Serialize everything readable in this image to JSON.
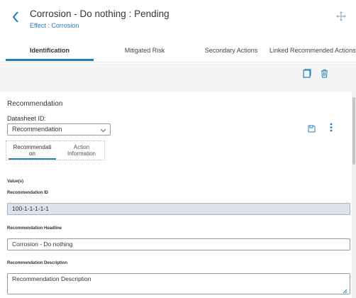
{
  "header": {
    "title": "Corrosion - Do nothing : Pending",
    "subtitle": "Effect : Corrosion"
  },
  "tabs": [
    {
      "label": "Identification",
      "active": true
    },
    {
      "label": "Mitigated Risk",
      "active": false
    },
    {
      "label": "Secondary Actions",
      "active": false
    },
    {
      "label": "Linked Recommended Actions",
      "active": false
    }
  ],
  "section": {
    "title": "Recommendation",
    "datasheet_label": "Datasheet ID:",
    "datasheet_value": "Recommendation"
  },
  "subtabs": [
    {
      "label": "Recommendati\non",
      "active": true
    },
    {
      "label": "Action\nInformation",
      "active": false
    }
  ],
  "form": {
    "values_label": "Value(s)",
    "fields": [
      {
        "label": "Recommendation ID",
        "value": "100-1-1-1-1-1",
        "readonly": true
      },
      {
        "label": "Recommendation Headline",
        "value": "Corrosion - Do nothing",
        "readonly": false
      },
      {
        "label": "Recommendation Description",
        "value": "Recommendation Description",
        "readonly": false
      }
    ]
  },
  "colors": {
    "accent": "#1f7fbf",
    "readonly_field": "#dde3ea",
    "band": "#f5f5f5"
  },
  "icons": [
    "chevron-left-icon",
    "move-icon",
    "copy-icon",
    "trash-icon",
    "chevron-down-icon",
    "save-icon",
    "kebab-icon",
    "resize-icon"
  ]
}
